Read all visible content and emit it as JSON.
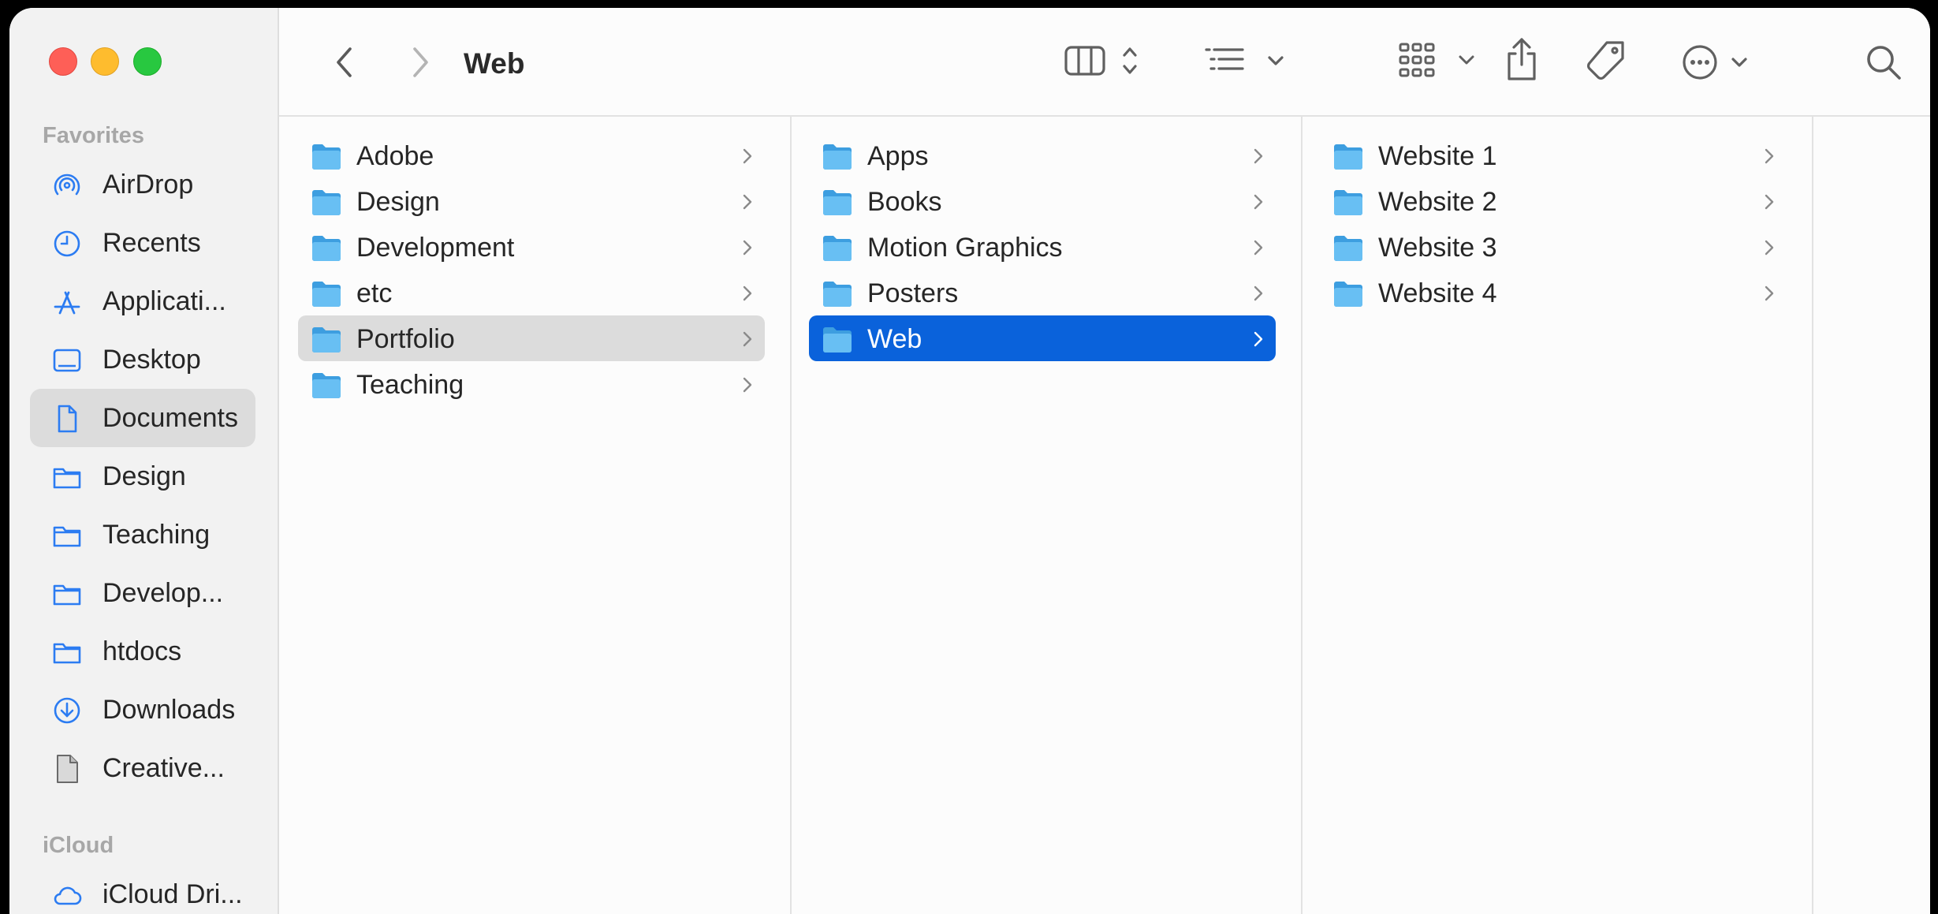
{
  "window": {
    "title": "Web"
  },
  "sidebar": {
    "favorites_header": "Favorites",
    "icloud_header": "iCloud",
    "items": [
      {
        "label": "AirDrop",
        "icon": "airdrop-icon"
      },
      {
        "label": "Recents",
        "icon": "clock-icon"
      },
      {
        "label": "Applicati...",
        "icon": "applications-icon"
      },
      {
        "label": "Desktop",
        "icon": "desktop-icon"
      },
      {
        "label": "Documents",
        "icon": "document-icon",
        "selected": true
      },
      {
        "label": "Design",
        "icon": "folder-outline-icon"
      },
      {
        "label": "Teaching",
        "icon": "folder-outline-icon"
      },
      {
        "label": "Develop...",
        "icon": "folder-outline-icon"
      },
      {
        "label": "htdocs",
        "icon": "folder-outline-icon"
      },
      {
        "label": "Downloads",
        "icon": "download-icon"
      },
      {
        "label": "Creative...",
        "icon": "file-icon"
      }
    ],
    "icloud_items": [
      {
        "label": "iCloud Dri...",
        "icon": "cloud-icon"
      }
    ]
  },
  "toolbar": {
    "back": "back-chevron-icon",
    "forward": "forward-chevron-icon",
    "view_mode": "columns-view-icon",
    "group": "list-group-icon",
    "gallery": "icon-grid-icon",
    "share": "share-icon",
    "tag": "tag-icon",
    "more": "ellipsis-circle-icon",
    "search": "search-icon"
  },
  "columns": [
    {
      "items": [
        {
          "label": "Adobe"
        },
        {
          "label": "Design"
        },
        {
          "label": "Development"
        },
        {
          "label": "etc"
        },
        {
          "label": "Portfolio",
          "selected": "inactive"
        },
        {
          "label": "Teaching"
        }
      ]
    },
    {
      "items": [
        {
          "label": "Apps"
        },
        {
          "label": "Books"
        },
        {
          "label": "Motion Graphics"
        },
        {
          "label": "Posters"
        },
        {
          "label": "Web",
          "selected": "active"
        }
      ]
    },
    {
      "items": [
        {
          "label": "Website 1"
        },
        {
          "label": "Website 2"
        },
        {
          "label": "Website 3"
        },
        {
          "label": "Website 4"
        }
      ]
    }
  ],
  "colors": {
    "accent": "#0a62db",
    "folder": "#5fb8f0",
    "sidebar_icon": "#2c7cf2"
  }
}
